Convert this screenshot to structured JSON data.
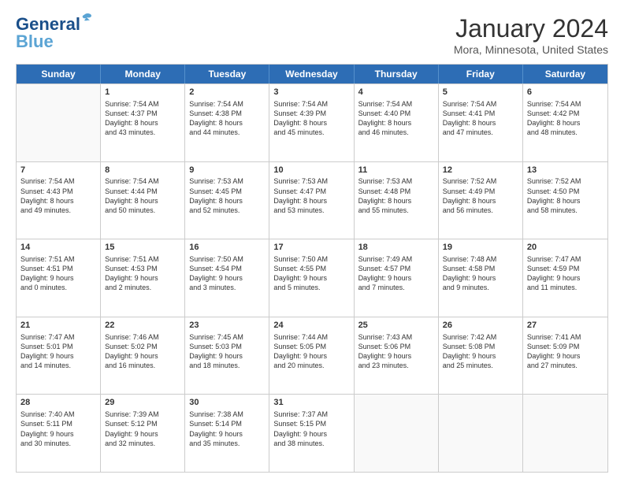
{
  "logo": {
    "line1": "General",
    "line2": "Blue"
  },
  "title": "January 2024",
  "subtitle": "Mora, Minnesota, United States",
  "header_days": [
    "Sunday",
    "Monday",
    "Tuesday",
    "Wednesday",
    "Thursday",
    "Friday",
    "Saturday"
  ],
  "rows": [
    [
      {
        "day": "",
        "empty": true
      },
      {
        "day": "1",
        "sunrise": "7:54 AM",
        "sunset": "4:37 PM",
        "daylight": "8 hours and 43 minutes."
      },
      {
        "day": "2",
        "sunrise": "7:54 AM",
        "sunset": "4:38 PM",
        "daylight": "8 hours and 44 minutes."
      },
      {
        "day": "3",
        "sunrise": "7:54 AM",
        "sunset": "4:39 PM",
        "daylight": "8 hours and 45 minutes."
      },
      {
        "day": "4",
        "sunrise": "7:54 AM",
        "sunset": "4:40 PM",
        "daylight": "8 hours and 46 minutes."
      },
      {
        "day": "5",
        "sunrise": "7:54 AM",
        "sunset": "4:41 PM",
        "daylight": "8 hours and 47 minutes."
      },
      {
        "day": "6",
        "sunrise": "7:54 AM",
        "sunset": "4:42 PM",
        "daylight": "8 hours and 48 minutes."
      }
    ],
    [
      {
        "day": "7",
        "sunrise": "7:54 AM",
        "sunset": "4:43 PM",
        "daylight": "8 hours and 49 minutes."
      },
      {
        "day": "8",
        "sunrise": "7:54 AM",
        "sunset": "4:44 PM",
        "daylight": "8 hours and 50 minutes."
      },
      {
        "day": "9",
        "sunrise": "7:53 AM",
        "sunset": "4:45 PM",
        "daylight": "8 hours and 52 minutes."
      },
      {
        "day": "10",
        "sunrise": "7:53 AM",
        "sunset": "4:47 PM",
        "daylight": "8 hours and 53 minutes."
      },
      {
        "day": "11",
        "sunrise": "7:53 AM",
        "sunset": "4:48 PM",
        "daylight": "8 hours and 55 minutes."
      },
      {
        "day": "12",
        "sunrise": "7:52 AM",
        "sunset": "4:49 PM",
        "daylight": "8 hours and 56 minutes."
      },
      {
        "day": "13",
        "sunrise": "7:52 AM",
        "sunset": "4:50 PM",
        "daylight": "8 hours and 58 minutes."
      }
    ],
    [
      {
        "day": "14",
        "sunrise": "7:51 AM",
        "sunset": "4:51 PM",
        "daylight": "9 hours and 0 minutes."
      },
      {
        "day": "15",
        "sunrise": "7:51 AM",
        "sunset": "4:53 PM",
        "daylight": "9 hours and 2 minutes."
      },
      {
        "day": "16",
        "sunrise": "7:50 AM",
        "sunset": "4:54 PM",
        "daylight": "9 hours and 3 minutes."
      },
      {
        "day": "17",
        "sunrise": "7:50 AM",
        "sunset": "4:55 PM",
        "daylight": "9 hours and 5 minutes."
      },
      {
        "day": "18",
        "sunrise": "7:49 AM",
        "sunset": "4:57 PM",
        "daylight": "9 hours and 7 minutes."
      },
      {
        "day": "19",
        "sunrise": "7:48 AM",
        "sunset": "4:58 PM",
        "daylight": "9 hours and 9 minutes."
      },
      {
        "day": "20",
        "sunrise": "7:47 AM",
        "sunset": "4:59 PM",
        "daylight": "9 hours and 11 minutes."
      }
    ],
    [
      {
        "day": "21",
        "sunrise": "7:47 AM",
        "sunset": "5:01 PM",
        "daylight": "9 hours and 14 minutes."
      },
      {
        "day": "22",
        "sunrise": "7:46 AM",
        "sunset": "5:02 PM",
        "daylight": "9 hours and 16 minutes."
      },
      {
        "day": "23",
        "sunrise": "7:45 AM",
        "sunset": "5:03 PM",
        "daylight": "9 hours and 18 minutes."
      },
      {
        "day": "24",
        "sunrise": "7:44 AM",
        "sunset": "5:05 PM",
        "daylight": "9 hours and 20 minutes."
      },
      {
        "day": "25",
        "sunrise": "7:43 AM",
        "sunset": "5:06 PM",
        "daylight": "9 hours and 23 minutes."
      },
      {
        "day": "26",
        "sunrise": "7:42 AM",
        "sunset": "5:08 PM",
        "daylight": "9 hours and 25 minutes."
      },
      {
        "day": "27",
        "sunrise": "7:41 AM",
        "sunset": "5:09 PM",
        "daylight": "9 hours and 27 minutes."
      }
    ],
    [
      {
        "day": "28",
        "sunrise": "7:40 AM",
        "sunset": "5:11 PM",
        "daylight": "9 hours and 30 minutes."
      },
      {
        "day": "29",
        "sunrise": "7:39 AM",
        "sunset": "5:12 PM",
        "daylight": "9 hours and 32 minutes."
      },
      {
        "day": "30",
        "sunrise": "7:38 AM",
        "sunset": "5:14 PM",
        "daylight": "9 hours and 35 minutes."
      },
      {
        "day": "31",
        "sunrise": "7:37 AM",
        "sunset": "5:15 PM",
        "daylight": "9 hours and 38 minutes."
      },
      {
        "day": "",
        "empty": true
      },
      {
        "day": "",
        "empty": true
      },
      {
        "day": "",
        "empty": true
      }
    ]
  ],
  "labels": {
    "sunrise": "Sunrise:",
    "sunset": "Sunset:",
    "daylight": "Daylight:"
  }
}
